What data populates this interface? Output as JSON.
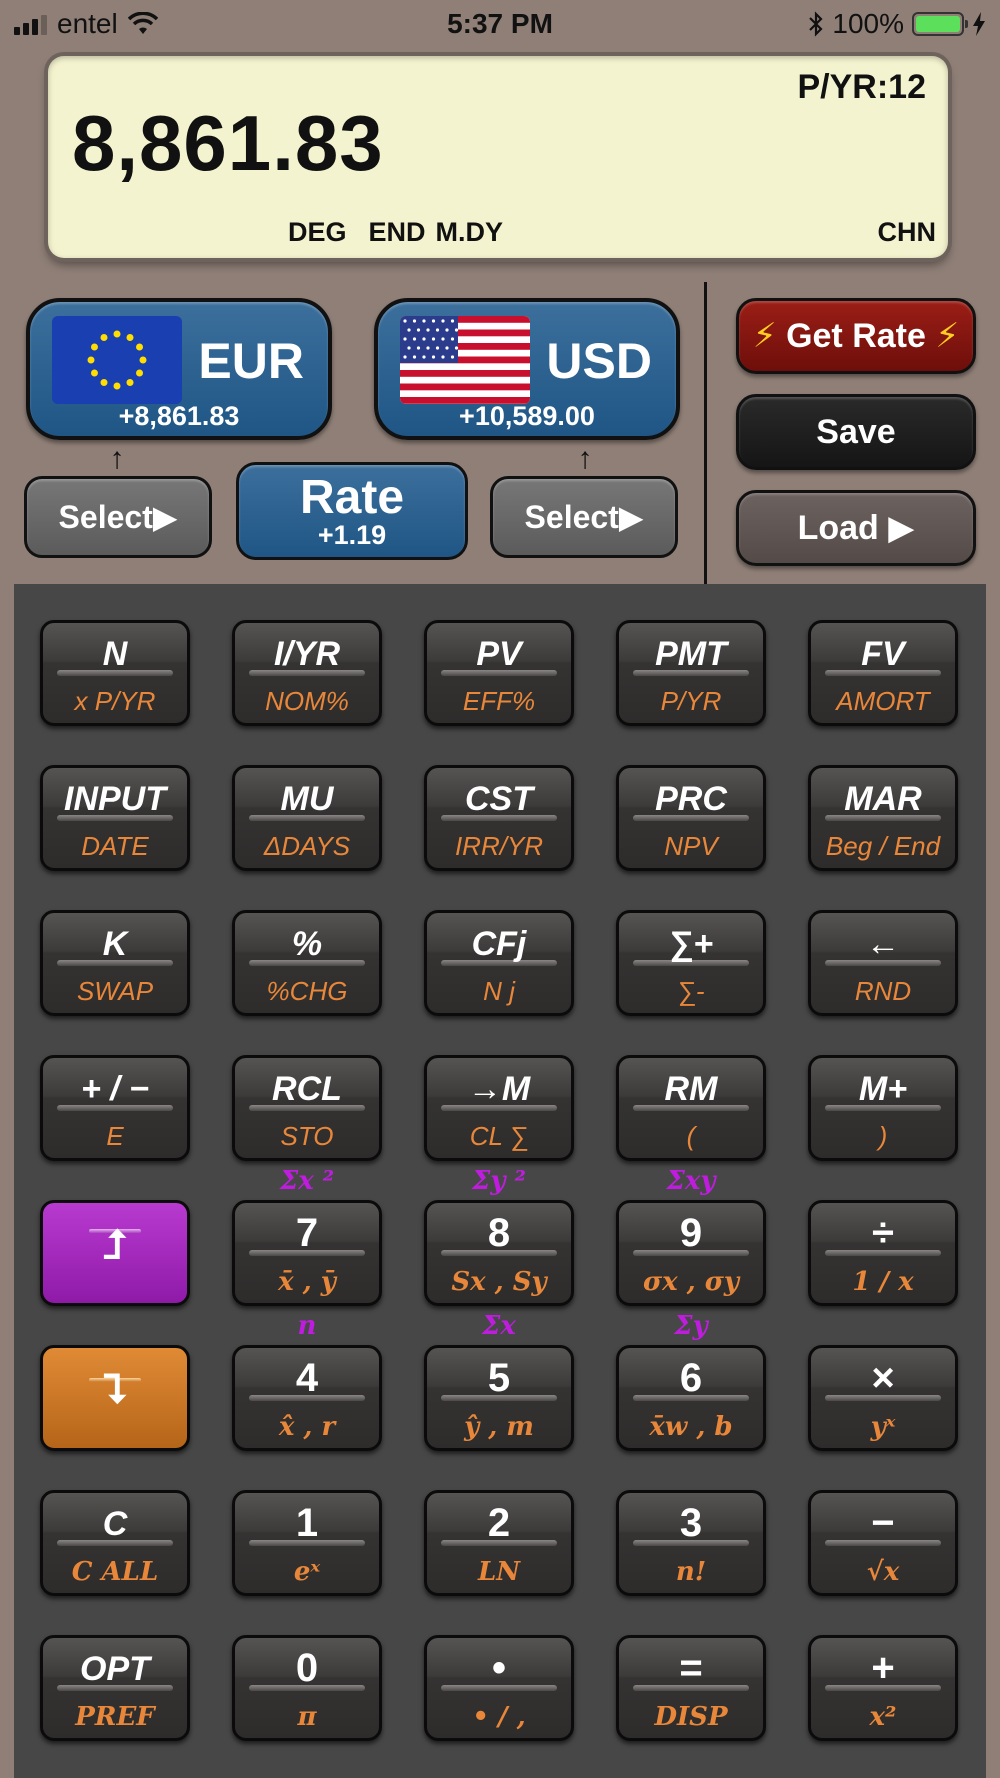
{
  "status_bar": {
    "carrier": "entel",
    "time": "5:37 PM",
    "battery": "100%",
    "icons": [
      "signal-icon",
      "wifi-icon",
      "bluetooth-icon",
      "battery-icon",
      "charging-icon"
    ]
  },
  "display": {
    "value": "8,861.83",
    "periods_per_year": "P/YR:12",
    "flag_deg": "DEG",
    "flag_end": "END",
    "flag_date": "M.DY",
    "language": "CHN"
  },
  "currency": {
    "from": {
      "code": "EUR",
      "amount": "+8,861.83",
      "flag": "eu-flag-icon"
    },
    "to": {
      "code": "USD",
      "amount": "+10,589.00",
      "flag": "us-flag-icon"
    },
    "select_label": "Select▶",
    "rate_label": "Rate",
    "rate_value": "+1.19",
    "arrow": "↑"
  },
  "side_buttons": {
    "get_rate": "Get Rate",
    "bolt": "⚡",
    "save": "Save",
    "load": "Load ▶"
  },
  "colors": {
    "background": "#8f7f77",
    "lcd": "#f4f3cf",
    "currency_blue": "#1f5685",
    "get_rate_red": "#8a1a12",
    "shift_orange": "#e8873a",
    "purple_shift": "#9c22b6",
    "stat_purple": "#c01ce0"
  },
  "stat_labels": {
    "row5": [
      "Σx ²",
      "Σy ²",
      "Σxy"
    ],
    "row6": [
      "n",
      "Σx",
      "Σy"
    ]
  },
  "keys": [
    [
      {
        "main": "N",
        "shift": "x P/YR"
      },
      {
        "main": "I/YR",
        "shift": "NOM%"
      },
      {
        "main": "PV",
        "shift": "EFF%"
      },
      {
        "main": "PMT",
        "shift": "P/YR"
      },
      {
        "main": "FV",
        "shift": "AMORT"
      }
    ],
    [
      {
        "main": "INPUT",
        "shift": "DATE"
      },
      {
        "main": "MU",
        "shift": "ΔDAYS"
      },
      {
        "main": "CST",
        "shift": "IRR/YR"
      },
      {
        "main": "PRC",
        "shift": "NPV"
      },
      {
        "main": "MAR",
        "shift": "Beg / End"
      }
    ],
    [
      {
        "main": "K",
        "shift": "SWAP"
      },
      {
        "main": "%",
        "shift": "%CHG"
      },
      {
        "main": "CFj",
        "shift": "N j"
      },
      {
        "main": "∑+",
        "shift": "∑-"
      },
      {
        "main": "←",
        "shift": "RND"
      }
    ],
    [
      {
        "main": "+ / −",
        "shift": "E"
      },
      {
        "main": "RCL",
        "shift": "STO"
      },
      {
        "main": "→M",
        "shift": "CL ∑"
      },
      {
        "main": "RM",
        "shift": "("
      },
      {
        "main": "M+",
        "shift": ")"
      }
    ],
    [
      {
        "main": "",
        "shift": ""
      },
      {
        "main": "7",
        "shift": "x̄ , ȳ"
      },
      {
        "main": "8",
        "shift": "Sx , Sy"
      },
      {
        "main": "9",
        "shift": "σx , σy"
      },
      {
        "main": "÷",
        "shift": "1 / x"
      }
    ],
    [
      {
        "main": "",
        "shift": ""
      },
      {
        "main": "4",
        "shift": "x̂ , r"
      },
      {
        "main": "5",
        "shift": "ŷ , m"
      },
      {
        "main": "6",
        "shift": "x̄w , b"
      },
      {
        "main": "×",
        "shift": "yˣ"
      }
    ],
    [
      {
        "main": "C",
        "shift": "C ALL"
      },
      {
        "main": "1",
        "shift": "eˣ"
      },
      {
        "main": "2",
        "shift": "LN"
      },
      {
        "main": "3",
        "shift": "n!"
      },
      {
        "main": "−",
        "shift": "√x"
      }
    ],
    [
      {
        "main": "OPT",
        "shift": "PREF"
      },
      {
        "main": "0",
        "shift": "π"
      },
      {
        "main": "•",
        "shift": "• / ,"
      },
      {
        "main": "=",
        "shift": "DISP"
      },
      {
        "main": "+",
        "shift": "x²"
      }
    ]
  ]
}
